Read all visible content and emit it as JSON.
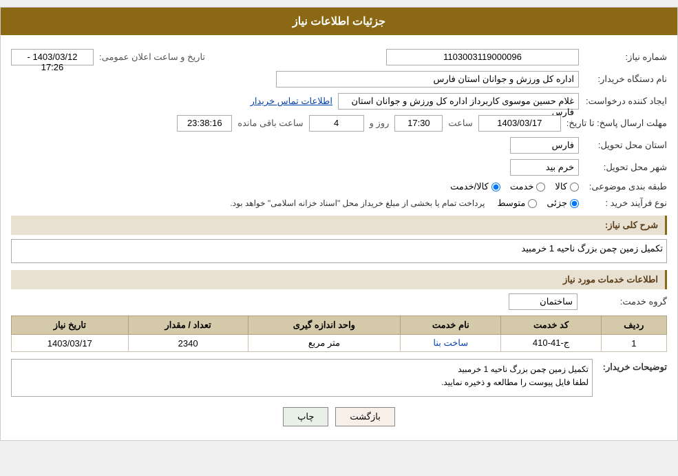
{
  "header": {
    "title": "جزئیات اطلاعات نیاز"
  },
  "fields": {
    "need_number_label": "شماره نیاز:",
    "need_number_value": "1103003119000096",
    "announcement_date_label": "تاریخ و ساعت اعلان عمومی:",
    "announcement_date_value": "1403/03/12 - 17:26",
    "org_name_label": "نام دستگاه خریدار:",
    "org_name_value": "اداره کل ورزش و جوانان استان فارس",
    "creator_label": "ایجاد کننده درخواست:",
    "creator_value": "غلام حسین موسوی کاربرداز اداره کل ورزش و جوانان استان فارس",
    "contact_link": "اطلاعات تماس خریدار",
    "deadline_label": "مهلت ارسال پاسخ: تا تاریخ:",
    "deadline_date": "1403/03/17",
    "deadline_time_label": "ساعت",
    "deadline_time": "17:30",
    "deadline_days_label": "روز و",
    "deadline_days": "4",
    "deadline_remaining_label": "ساعت باقی مانده",
    "deadline_remaining": "23:38:16",
    "province_label": "استان محل تحویل:",
    "province_value": "فارس",
    "city_label": "شهر محل تحویل:",
    "city_value": "خرم بید",
    "category_label": "طبقه بندی موضوعی:",
    "radio_kala": "کالا",
    "radio_khadamat": "خدمت",
    "radio_kala_khadamat": "کالا/خدمت",
    "purchase_type_label": "نوع فرآیند خرید :",
    "radio_jozvi": "جزئی",
    "radio_motevaset": "متوسط",
    "purchase_text": "پرداخت تمام يا بخشی از مبلغ خریداز محل \"اسناد خزانه اسلامی\" خواهد بود.",
    "need_description_label": "شرح کلی نیاز:",
    "need_description_value": "تکمیل زمین چمن بزرگ ناحیه 1 خرمبید",
    "services_info_label": "اطلاعات خدمات مورد نیاز",
    "service_group_label": "گروه خدمت:",
    "service_group_value": "ساختمان",
    "table": {
      "col_row_number": "ردیف",
      "col_service_code": "کد خدمت",
      "col_service_name": "نام خدمت",
      "col_unit": "واحد اندازه گیری",
      "col_quantity": "تعداد / مقدار",
      "col_date": "تاریخ نیاز",
      "rows": [
        {
          "row_number": "1",
          "service_code": "ج-41-410",
          "service_name": "ساخت بنا",
          "unit": "متر مربع",
          "quantity": "2340",
          "date": "1403/03/17"
        }
      ]
    },
    "buyer_desc_label": "توضیحات خریدار:",
    "buyer_desc_line1": "تکمیل زمین چمن بزرگ ناحیه 1 خرمبید",
    "buyer_desc_line2": "لطفا فایل پیوست را مطالعه و ذخیره نمایید.",
    "btn_print": "چاپ",
    "btn_back": "بازگشت"
  }
}
